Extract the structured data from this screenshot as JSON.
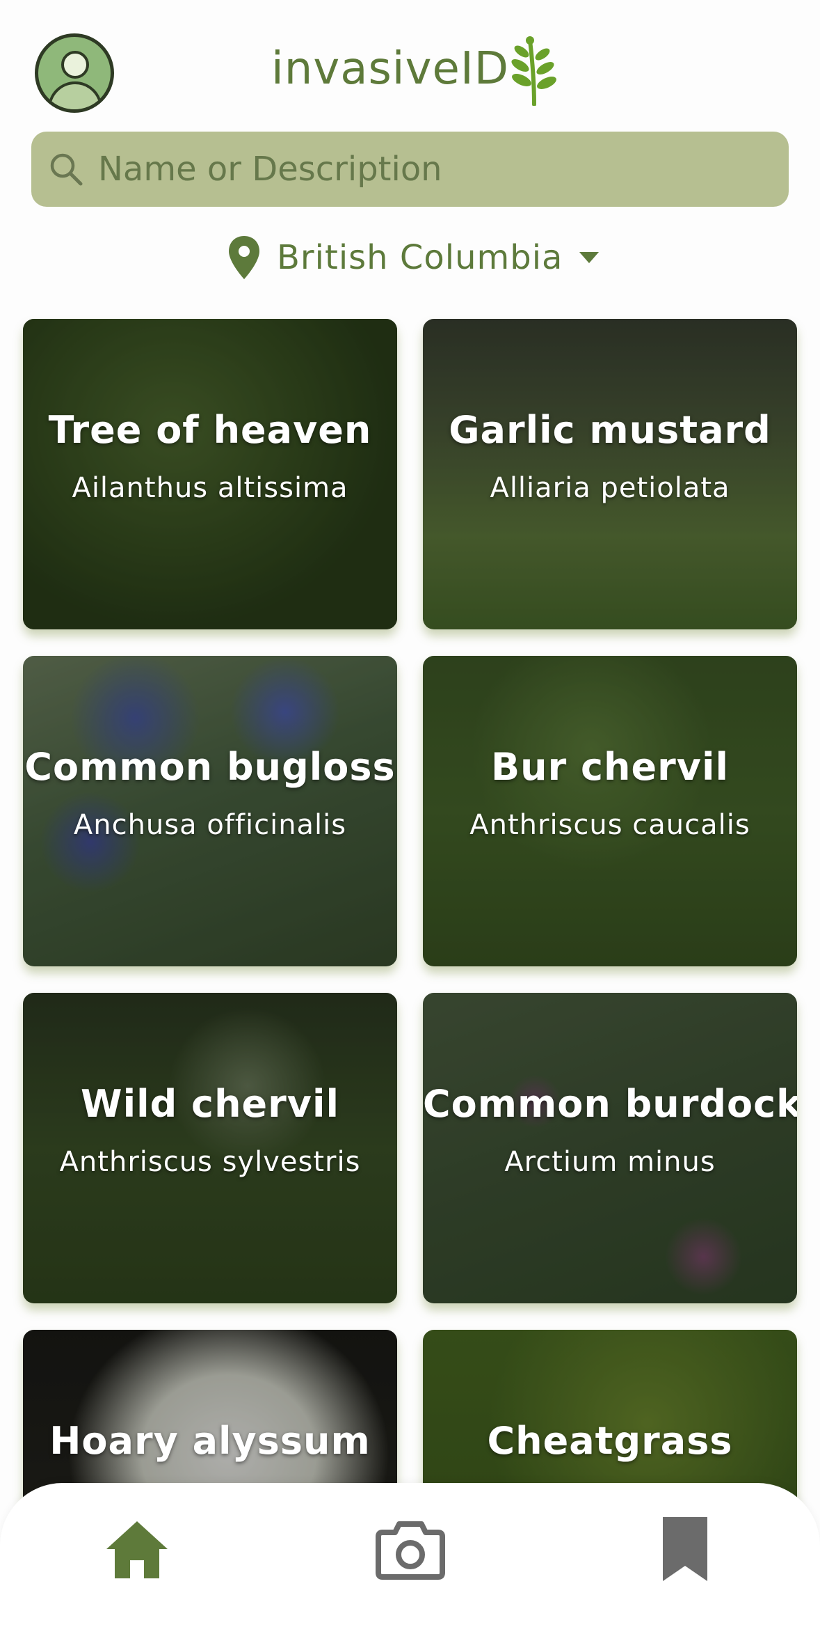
{
  "app": {
    "title": "invasiveID"
  },
  "search": {
    "placeholder": "Name or Description"
  },
  "location": {
    "label": "British Columbia"
  },
  "colors": {
    "accent": "#5e7a3a",
    "search_bg": "#b6bf91",
    "leaf": "#6aa12a",
    "tab_inactive": "#6b6b6b"
  },
  "cards": [
    {
      "name": "Tree of heaven",
      "scientific": "Ailanthus altissima"
    },
    {
      "name": "Garlic mustard",
      "scientific": "Alliaria petiolata"
    },
    {
      "name": "Common bugloss",
      "scientific": "Anchusa officinalis"
    },
    {
      "name": "Bur chervil",
      "scientific": "Anthriscus caucalis"
    },
    {
      "name": "Wild chervil",
      "scientific": "Anthriscus sylvestris"
    },
    {
      "name": "Common burdock",
      "scientific": "Arctium minus"
    },
    {
      "name": "Hoary alyssum",
      "scientific": ""
    },
    {
      "name": "Cheatgrass",
      "scientific": ""
    }
  ],
  "tabs": [
    {
      "icon": "home-icon",
      "active": true
    },
    {
      "icon": "camera-icon",
      "active": false
    },
    {
      "icon": "bookmark-icon",
      "active": false
    }
  ]
}
